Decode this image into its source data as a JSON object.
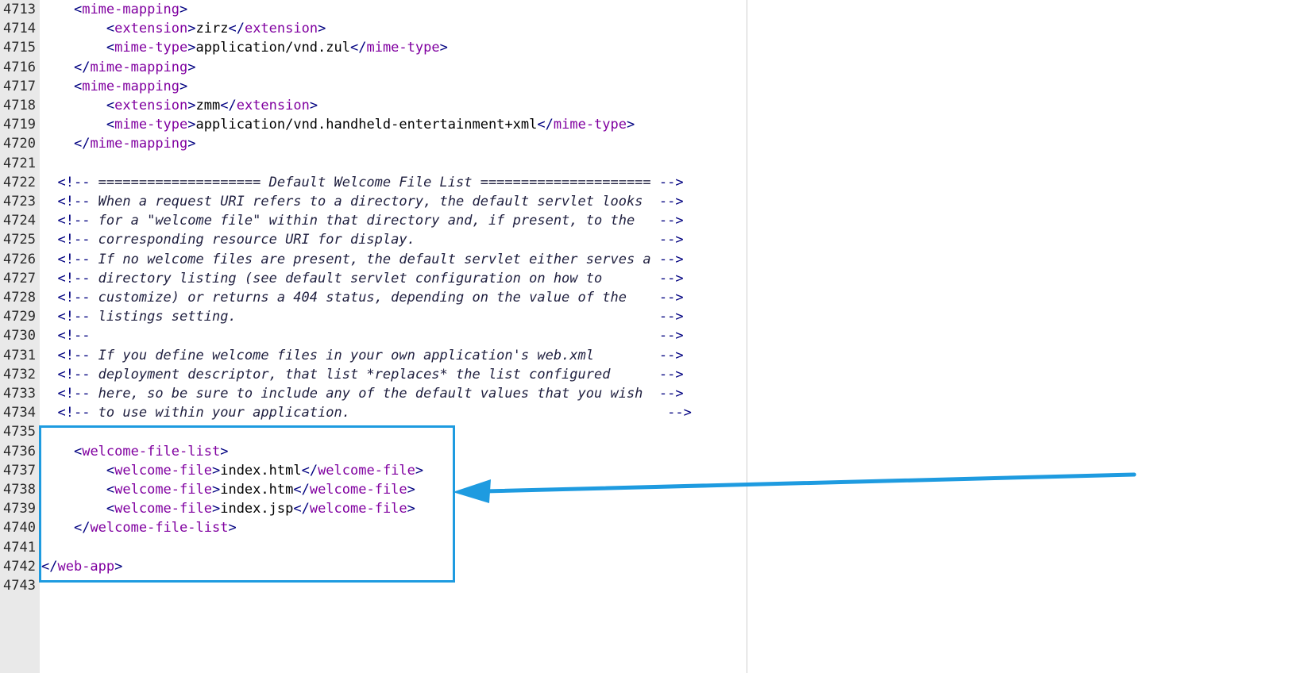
{
  "editor": {
    "lines": [
      {
        "num": "4713",
        "indent": "    ",
        "kind": "open",
        "tag": "mime-mapping"
      },
      {
        "num": "4714",
        "indent": "        ",
        "kind": "elem",
        "tag": "extension",
        "value": "zirz"
      },
      {
        "num": "4715",
        "indent": "        ",
        "kind": "elem",
        "tag": "mime-type",
        "value": "application/vnd.zul"
      },
      {
        "num": "4716",
        "indent": "    ",
        "kind": "close",
        "tag": "mime-mapping"
      },
      {
        "num": "4717",
        "indent": "    ",
        "kind": "open",
        "tag": "mime-mapping"
      },
      {
        "num": "4718",
        "indent": "        ",
        "kind": "elem",
        "tag": "extension",
        "value": "zmm"
      },
      {
        "num": "4719",
        "indent": "        ",
        "kind": "elem",
        "tag": "mime-type",
        "value": "application/vnd.handheld-entertainment+xml"
      },
      {
        "num": "4720",
        "indent": "    ",
        "kind": "close",
        "tag": "mime-mapping"
      },
      {
        "num": "4721",
        "indent": "",
        "kind": "blank"
      },
      {
        "num": "4722",
        "indent": "  ",
        "kind": "comment",
        "text": " ==================== Default Welcome File List ===================== "
      },
      {
        "num": "4723",
        "indent": "  ",
        "kind": "comment",
        "text": " When a request URI refers to a directory, the default servlet looks  "
      },
      {
        "num": "4724",
        "indent": "  ",
        "kind": "comment",
        "text": " for a \"welcome file\" within that directory and, if present, to the   "
      },
      {
        "num": "4725",
        "indent": "  ",
        "kind": "comment",
        "text": " corresponding resource URI for display.                              "
      },
      {
        "num": "4726",
        "indent": "  ",
        "kind": "comment",
        "text": " If no welcome files are present, the default servlet either serves a "
      },
      {
        "num": "4727",
        "indent": "  ",
        "kind": "comment",
        "text": " directory listing (see default servlet configuration on how to       "
      },
      {
        "num": "4728",
        "indent": "  ",
        "kind": "comment",
        "text": " customize) or returns a 404 status, depending on the value of the    "
      },
      {
        "num": "4729",
        "indent": "  ",
        "kind": "comment",
        "text": " listings setting.                                                    "
      },
      {
        "num": "4730",
        "indent": "  ",
        "kind": "comment",
        "text": "                                                                      "
      },
      {
        "num": "4731",
        "indent": "  ",
        "kind": "comment",
        "text": " If you define welcome files in your own application's web.xml        "
      },
      {
        "num": "4732",
        "indent": "  ",
        "kind": "comment",
        "text": " deployment descriptor, that list *replaces* the list configured      "
      },
      {
        "num": "4733",
        "indent": "  ",
        "kind": "comment",
        "text": " here, so be sure to include any of the default values that you wish  "
      },
      {
        "num": "4734",
        "indent": "  ",
        "kind": "comment",
        "text": " to use within your application.                                       "
      },
      {
        "num": "4735",
        "indent": "",
        "kind": "blank"
      },
      {
        "num": "4736",
        "indent": "    ",
        "kind": "open",
        "tag": "welcome-file-list"
      },
      {
        "num": "4737",
        "indent": "        ",
        "kind": "elem",
        "tag": "welcome-file",
        "value": "index.html"
      },
      {
        "num": "4738",
        "indent": "        ",
        "kind": "elem",
        "tag": "welcome-file",
        "value": "index.htm"
      },
      {
        "num": "4739",
        "indent": "        ",
        "kind": "elem",
        "tag": "welcome-file",
        "value": "index.jsp"
      },
      {
        "num": "4740",
        "indent": "    ",
        "kind": "close",
        "tag": "welcome-file-list"
      },
      {
        "num": "4741",
        "indent": "",
        "kind": "blank"
      },
      {
        "num": "4742",
        "indent": "",
        "kind": "close",
        "tag": "web-app"
      },
      {
        "num": "4743",
        "indent": "",
        "kind": "blank"
      }
    ]
  },
  "annotation": {
    "highlight_color": "#1e9be0",
    "arrow_color": "#1e9be0",
    "arrow_icon": "arrow-left-icon"
  },
  "colors": {
    "tag": "#8000a0",
    "bracket": "#000080",
    "comment": "#202040",
    "gutter_bg": "#e9e9e9"
  }
}
